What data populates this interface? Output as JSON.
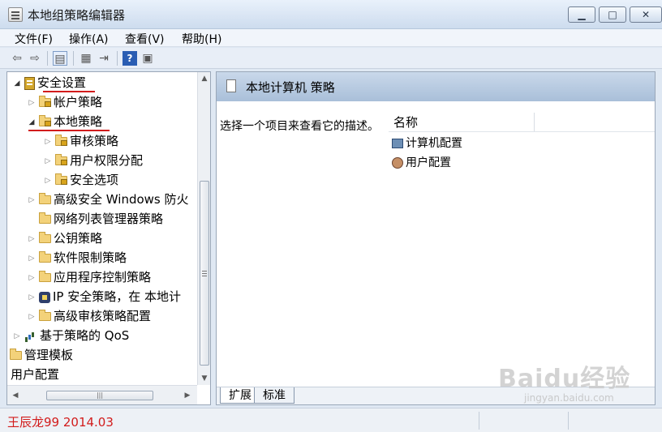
{
  "window": {
    "title": "本地组策略编辑器"
  },
  "menu": [
    "文件(F)",
    "操作(A)",
    "查看(V)",
    "帮助(H)"
  ],
  "tree": [
    {
      "label": "安全设置",
      "level": 0,
      "icon": "security-icon",
      "arrow": "expanded"
    },
    {
      "label": "帐户策略",
      "level": 1,
      "icon": "lock-folder-icon",
      "arrow": "collapsed"
    },
    {
      "label": "本地策略",
      "level": 1,
      "icon": "lock-folder-icon",
      "arrow": "expanded"
    },
    {
      "label": "审核策略",
      "level": 2,
      "icon": "lock-folder-icon",
      "arrow": "collapsed"
    },
    {
      "label": "用户权限分配",
      "level": 2,
      "icon": "lock-folder-icon",
      "arrow": "collapsed"
    },
    {
      "label": "安全选项",
      "level": 2,
      "icon": "lock-folder-icon",
      "arrow": "collapsed"
    },
    {
      "label": "高级安全 Windows 防火",
      "level": 1,
      "icon": "folder-icon",
      "arrow": "collapsed"
    },
    {
      "label": "网络列表管理器策略",
      "level": 1,
      "icon": "folder-icon",
      "arrow": "none"
    },
    {
      "label": "公钥策略",
      "level": 1,
      "icon": "folder-icon",
      "arrow": "collapsed"
    },
    {
      "label": "软件限制策略",
      "level": 1,
      "icon": "folder-icon",
      "arrow": "collapsed"
    },
    {
      "label": "应用程序控制策略",
      "level": 1,
      "icon": "folder-icon",
      "arrow": "collapsed"
    },
    {
      "label": "IP 安全策略，在 本地计",
      "level": 1,
      "icon": "ip-security-icon",
      "arrow": "collapsed"
    },
    {
      "label": "高级审核策略配置",
      "level": 1,
      "icon": "folder-icon",
      "arrow": "collapsed"
    },
    {
      "label": "基于策略的 QoS",
      "level": 0,
      "icon": "qos-icon",
      "arrow": "collapsed"
    },
    {
      "label": "管理模板",
      "level": -1,
      "icon": "folder-icon",
      "arrow": "none"
    },
    {
      "label": "用户配置",
      "level": -2,
      "icon": "none",
      "arrow": "none"
    }
  ],
  "right": {
    "header": "本地计算机 策略",
    "description": "选择一个项目来查看它的描述。",
    "column": "名称",
    "items": [
      "计算机配置",
      "用户配置"
    ],
    "tabs": [
      "扩展",
      "标准"
    ]
  },
  "status": {
    "text": "王辰龙99 2014.03"
  },
  "watermark": {
    "main": "Baidu经验",
    "sub": "jingyan.baidu.com"
  },
  "colors": {
    "annotation": "#d21c1c",
    "header": "#a9bfd9"
  }
}
